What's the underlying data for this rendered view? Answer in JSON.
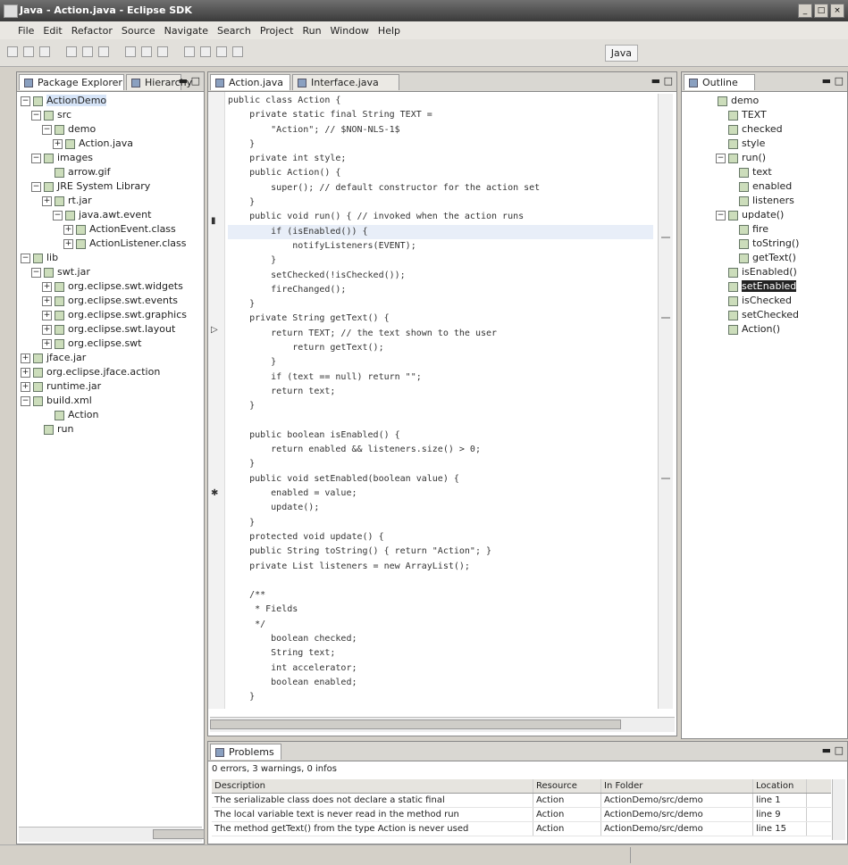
{
  "window": {
    "title": "Java - Action.java - Eclipse SDK"
  },
  "menu": [
    "File",
    "Edit",
    "Refactor",
    "Source",
    "Navigate",
    "Search",
    "Project",
    "Run",
    "Window",
    "Help"
  ],
  "toolbar": {
    "perspective": "Java"
  },
  "package_explorer": {
    "tab_label": "Package Explorer",
    "tab2_label": "Hierarchy",
    "items": [
      {
        "label": "ActionDemo",
        "depth": 0,
        "exp": "−",
        "sel": true
      },
      {
        "label": "src",
        "depth": 1,
        "exp": "−"
      },
      {
        "label": "demo",
        "depth": 2,
        "exp": "−"
      },
      {
        "label": "Action.java",
        "depth": 3,
        "exp": "+"
      },
      {
        "label": "images",
        "depth": 1,
        "exp": "−"
      },
      {
        "label": "arrow.gif",
        "depth": 2,
        "exp": ""
      },
      {
        "label": "JRE System Library",
        "depth": 1,
        "exp": "−"
      },
      {
        "label": "rt.jar",
        "depth": 2,
        "exp": "+"
      },
      {
        "label": "java.awt.event",
        "depth": 3,
        "exp": "−"
      },
      {
        "label": "ActionEvent.class",
        "depth": 4,
        "exp": "+"
      },
      {
        "label": "ActionListener.class",
        "depth": 4,
        "exp": "+"
      },
      {
        "label": "lib",
        "depth": 0,
        "exp": "−"
      },
      {
        "label": "swt.jar",
        "depth": 1,
        "exp": "−"
      },
      {
        "label": "org.eclipse.swt.widgets",
        "depth": 2,
        "exp": "+"
      },
      {
        "label": "org.eclipse.swt.events",
        "depth": 2,
        "exp": "+"
      },
      {
        "label": "org.eclipse.swt.graphics",
        "depth": 2,
        "exp": "+"
      },
      {
        "label": "org.eclipse.swt.layout",
        "depth": 2,
        "exp": "+"
      },
      {
        "label": "org.eclipse.swt",
        "depth": 2,
        "exp": "+"
      },
      {
        "label": "jface.jar",
        "depth": 0,
        "exp": "+"
      },
      {
        "label": "org.eclipse.jface.action",
        "depth": 0,
        "exp": "+"
      },
      {
        "label": "runtime.jar",
        "depth": 0,
        "exp": "+"
      },
      {
        "label": "build.xml",
        "depth": 0,
        "exp": "−"
      },
      {
        "label": "Action",
        "depth": 2,
        "exp": ""
      },
      {
        "label": "run",
        "depth": 1,
        "exp": ""
      }
    ]
  },
  "editor": {
    "tab_label": "Action.java",
    "tab2_label": "Interface.java",
    "lines": [
      "public class Action {",
      "    private static final String TEXT =",
      "        \"Action\"; // $NON-NLS-1$",
      "    }",
      "    private int style;",
      "    public Action() {",
      "        super(); // default constructor for the action set",
      "    }",
      "    public void run() { // invoked when the action runs",
      "        if (isEnabled()) {",
      "            notifyListeners(EVENT);",
      "        }",
      "        setChecked(!isChecked());",
      "        fireChanged();",
      "    }",
      "    private String getText() {",
      "        return TEXT; // the text shown to the user",
      "            return getText();",
      "        }",
      "        if (text == null) return \"\";",
      "        return text;",
      "    }",
      "",
      "    public boolean isEnabled() {",
      "        return enabled && listeners.size() > 0;",
      "    }",
      "    public void setEnabled(boolean value) {",
      "        enabled = value;",
      "        update();",
      "    }",
      "    protected void update() {",
      "    public String toString() { return \"Action\"; }",
      "    private List listeners = new ArrayList();",
      "",
      "    /**",
      "     * Fields",
      "     */",
      "        boolean checked;",
      "        String text;",
      "        int accelerator;",
      "        boolean enabled;",
      "    }"
    ]
  },
  "outline": {
    "tab_label": "Outline",
    "items": [
      {
        "label": "demo",
        "depth": 0,
        "exp": ""
      },
      {
        "label": "TEXT",
        "depth": 1,
        "exp": ""
      },
      {
        "label": "checked",
        "depth": 1,
        "exp": ""
      },
      {
        "label": "style",
        "depth": 1,
        "exp": ""
      },
      {
        "label": "run()",
        "depth": 1,
        "exp": "−"
      },
      {
        "label": "text",
        "depth": 2,
        "exp": ""
      },
      {
        "label": "enabled",
        "depth": 2,
        "exp": ""
      },
      {
        "label": "listeners",
        "depth": 2,
        "exp": ""
      },
      {
        "label": "update()",
        "depth": 1,
        "exp": "−"
      },
      {
        "label": "fire",
        "depth": 2,
        "exp": ""
      },
      {
        "label": "toString()",
        "depth": 2,
        "exp": ""
      },
      {
        "label": "getText()",
        "depth": 2,
        "exp": ""
      },
      {
        "label": "isEnabled()",
        "depth": 1,
        "exp": ""
      },
      {
        "label": "setEnabled",
        "depth": 1,
        "exp": "",
        "dark": true
      },
      {
        "label": "isChecked",
        "depth": 1,
        "exp": ""
      },
      {
        "label": "setChecked",
        "depth": 1,
        "exp": ""
      },
      {
        "label": "Action()",
        "depth": 1,
        "exp": ""
      }
    ]
  },
  "problems": {
    "tab_label": "Problems",
    "summary": "0 errors, 3 warnings, 0 infos",
    "columns": [
      "Description",
      "Resource",
      "In Folder",
      "Location"
    ],
    "rows": [
      [
        "The serializable class does not declare a static final",
        "Action",
        "ActionDemo/src/demo",
        "line 1"
      ],
      [
        "The local variable text is never read in the method run",
        "Action",
        "ActionDemo/src/demo",
        "line 9"
      ],
      [
        "The method getText() from the type Action is never used",
        "Action",
        "ActionDemo/src/demo",
        "line 15"
      ]
    ]
  }
}
